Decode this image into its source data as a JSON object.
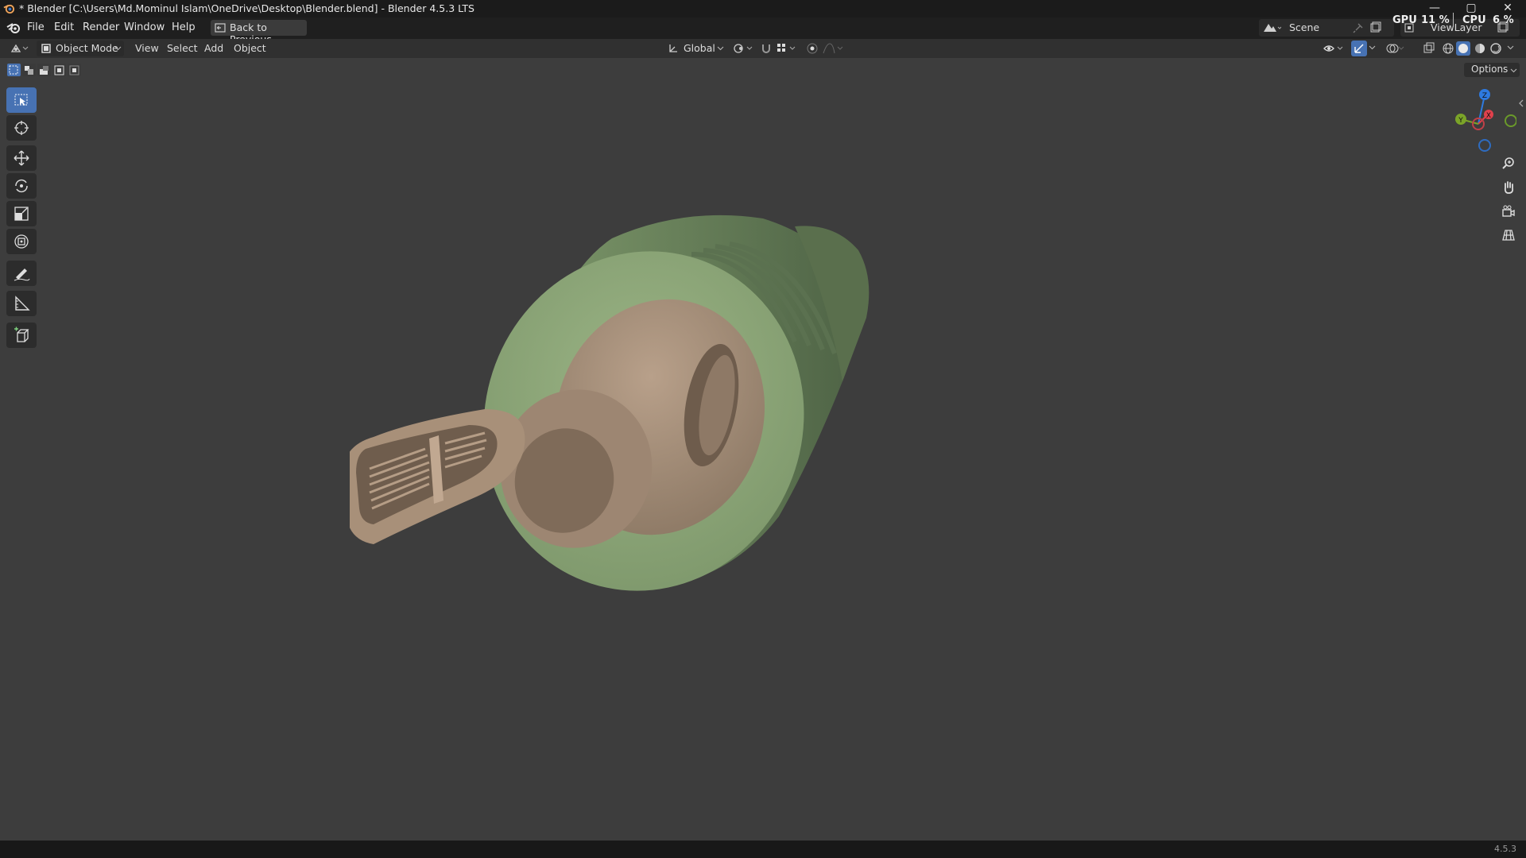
{
  "window": {
    "title": "* Blender [C:\\Users\\Md.Mominul Islam\\OneDrive\\Desktop\\Blender.blend] - Blender 4.5.3 LTS",
    "controls": {
      "minimize": "—",
      "maximize": "▢",
      "close": "✕"
    }
  },
  "menu": {
    "items": [
      "File",
      "Edit",
      "Render",
      "Window",
      "Help"
    ],
    "back_button": "Back to Previous",
    "scene_label": "Scene",
    "viewlayer_label": "ViewLayer"
  },
  "stats": {
    "gpu_label": "GPU",
    "gpu_value": "11 %",
    "cpu_label": "CPU",
    "cpu_value": "6 %"
  },
  "viewport_header": {
    "mode": "Object Mode",
    "menus": [
      "View",
      "Select",
      "Add",
      "Object"
    ],
    "transform_orientation": "Global",
    "options_label": "Options"
  },
  "tools": [
    "select-box",
    "cursor",
    "move",
    "rotate",
    "scale",
    "transform",
    "annotate",
    "measure",
    "add-cube"
  ],
  "gizmo": {
    "axes": {
      "z": "Z",
      "x": "X",
      "y": "Y"
    },
    "colors": {
      "x": "#e0414c",
      "y": "#7ba428",
      "z": "#2e7ae0"
    }
  },
  "colors": {
    "accent": "#4772b3",
    "viewport_bg": "#3d3d3d",
    "object_green": "#8ea87a",
    "object_tan": "#a08b75"
  },
  "status": {
    "version": "4.5.3"
  }
}
